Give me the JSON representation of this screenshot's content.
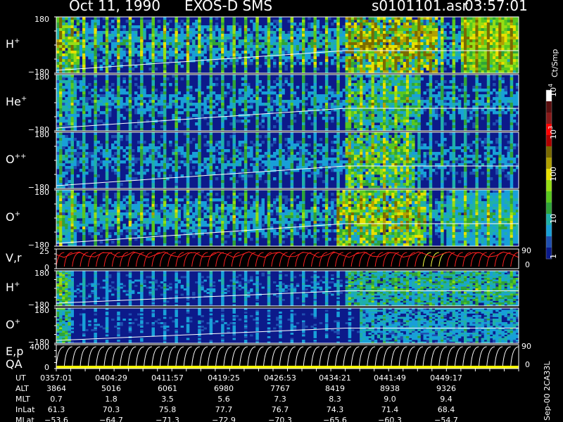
{
  "header": {
    "date": "Oct 11, 1990",
    "instrument": "EXOS-D SMS",
    "filename": "s0101101.asr",
    "time": "03:57:01"
  },
  "colorbar": {
    "unit": "Ct/Smp",
    "colors": [
      "#0a1a8c",
      "#1f4fb0",
      "#18a0d8",
      "#1fb0a8",
      "#2ea43a",
      "#58c81e",
      "#96de14",
      "#e8e000",
      "#b0a000",
      "#7a6a00",
      "#b00000",
      "#ff0000",
      "#8a1a1a",
      "#5a0f0f",
      "#ffffff"
    ]
  },
  "panels": [
    {
      "id": "h-plus-top",
      "label": "H",
      "sup": "+",
      "ymax": "180",
      "ymin": "−180",
      "type": "spectrogram"
    },
    {
      "id": "he-plus",
      "label": "He",
      "sup": "+",
      "ymax": "180",
      "ymin": "−180",
      "type": "spectrogram"
    },
    {
      "id": "o-plus-plus",
      "label": "O",
      "sup": "++",
      "ymax": "180",
      "ymin": "−180",
      "type": "spectrogram"
    },
    {
      "id": "o-plus-top",
      "label": "O",
      "sup": "+",
      "ymax": "180",
      "ymin": "−180",
      "type": "spectrogram"
    },
    {
      "id": "vr",
      "label": "V,r",
      "sup": "",
      "ymax": "25",
      "ymin": "0",
      "type": "line",
      "right_max": "90",
      "right_min": "0"
    },
    {
      "id": "h-plus-low",
      "label": "H",
      "sup": "+",
      "ymax": "180",
      "ymin": "−180",
      "type": "spectrogram"
    },
    {
      "id": "o-plus-low",
      "label": "O",
      "sup": "+",
      "ymax": "180",
      "ymin": "−180",
      "type": "spectrogram"
    },
    {
      "id": "ep-qa",
      "label": "E,p",
      "label2": "QA",
      "sup": "",
      "ymax": "4000",
      "ymin": "0",
      "type": "line",
      "right_max": "90",
      "right_min": "0"
    }
  ],
  "footer": {
    "side_text": "Sep-00  2CA33L",
    "rows": [
      {
        "name": "UT",
        "values": [
          "0357:01",
          "0404:29",
          "0411:57",
          "0419:25",
          "0426:53",
          "0434:21",
          "0441:49",
          "0449:17"
        ]
      },
      {
        "name": "ALT",
        "values": [
          "3864",
          "5016",
          "6061",
          "6980",
          "7767",
          "8419",
          "8938",
          "9326"
        ]
      },
      {
        "name": "MLT",
        "values": [
          "0.7",
          "1.8",
          "3.5",
          "5.6",
          "7.3",
          "8.3",
          "9.0",
          "9.4"
        ]
      },
      {
        "name": "InLat",
        "values": [
          "61.3",
          "70.3",
          "75.8",
          "77.7",
          "76.7",
          "74.3",
          "71.4",
          "68.4"
        ]
      },
      {
        "name": "MLat",
        "values": [
          "−53.6",
          "−64.7",
          "−71.3",
          "−72.9",
          "−70.3",
          "−65.6",
          "−60.3",
          "−54.7"
        ]
      }
    ]
  },
  "chart_data": {
    "type": "heatmap",
    "title": "Oct 11, 1990   EXOS-D SMS",
    "x": [
      "0357:01",
      "0404:29",
      "0411:57",
      "0419:25",
      "0426:53",
      "0434:21",
      "0441:49",
      "0449:17"
    ],
    "colorbar_ticks": [
      "1",
      "10",
      "100",
      "10^3",
      "10^4"
    ],
    "colorbar_unit": "Ct/Smp",
    "series": [
      {
        "name": "H+",
        "ylim": [
          -180,
          180
        ],
        "features": "banded spin-modulated fluxes, intensifying after 0434:21, strong green at end"
      },
      {
        "name": "He+",
        "ylim": [
          -180,
          180
        ]
      },
      {
        "name": "O++",
        "ylim": [
          -180,
          180
        ]
      },
      {
        "name": "O+",
        "ylim": [
          -180,
          180
        ]
      },
      {
        "name": "V,r",
        "ylim": [
          0,
          25
        ],
        "right_ylim": [
          0,
          90
        ]
      },
      {
        "name": "H+",
        "ylim": [
          -180,
          180
        ]
      },
      {
        "name": "O+",
        "ylim": [
          -180,
          180
        ]
      },
      {
        "name": "E,p QA",
        "ylim": [
          0,
          4000
        ],
        "right_ylim": [
          0,
          90
        ]
      }
    ]
  }
}
